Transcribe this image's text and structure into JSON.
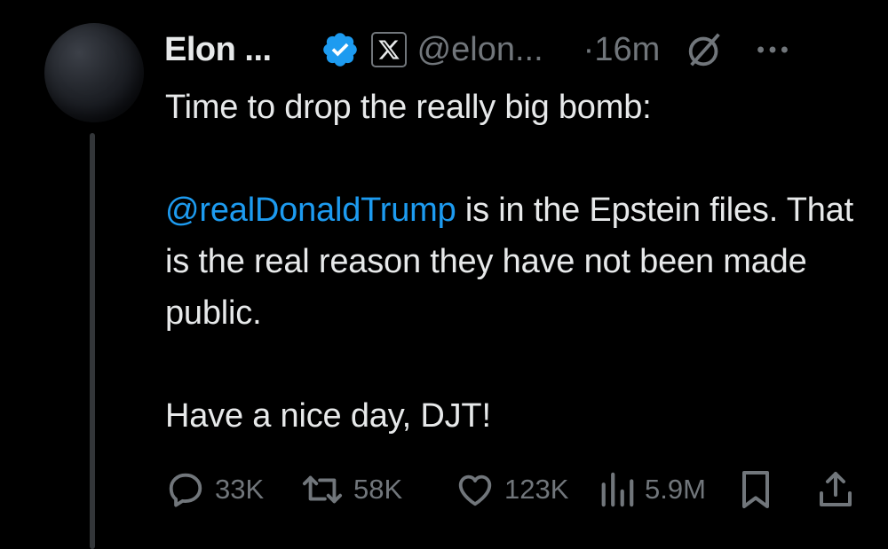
{
  "tweet": {
    "author": {
      "name": "Elon ...",
      "handle": "@elon...",
      "verified": true,
      "affiliation_icon": "x-logo-icon"
    },
    "timestamp_prefix": "·",
    "timestamp": "16m",
    "text": {
      "line1": "Time to drop the really big bomb:",
      "mention": "@realDonaldTrump",
      "after_mention": " is in the Epstein files. That is the real reason they have not been made public.",
      "closing": "Have a nice day, DJT!"
    },
    "metrics": {
      "replies": "33K",
      "reposts": "58K",
      "likes": "123K",
      "views": "5.9M"
    }
  },
  "colors": {
    "background": "#000000",
    "text": "#e7e9ea",
    "muted": "#71767b",
    "accent": "#1d9bf0"
  }
}
